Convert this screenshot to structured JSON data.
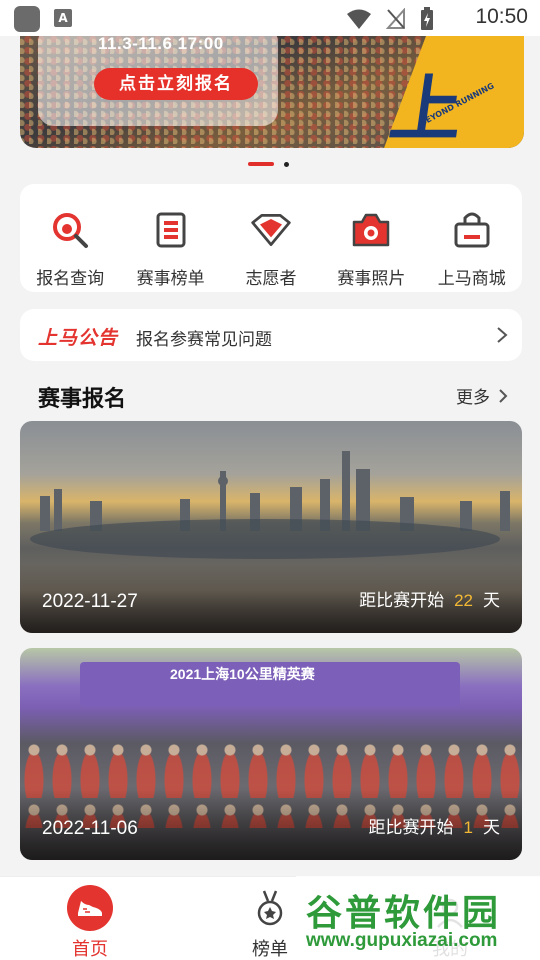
{
  "status_bar": {
    "time": "10:50"
  },
  "banner": {
    "date_text": "11.3-11.6 17:00",
    "button_label": "点击立刻报名",
    "logo_text": "上马",
    "logo_small": "BEYOND RUNNING"
  },
  "quick_menu": [
    {
      "label": "报名查询",
      "icon": "search-icon"
    },
    {
      "label": "赛事榜单",
      "icon": "list-icon"
    },
    {
      "label": "志愿者",
      "icon": "diamond-icon"
    },
    {
      "label": "赛事照片",
      "icon": "camera-icon"
    },
    {
      "label": "上马商城",
      "icon": "shop-bag-icon"
    }
  ],
  "notice": {
    "tag": "上马公告",
    "text": "报名参赛常见问题"
  },
  "section": {
    "title": "赛事报名",
    "more": "更多"
  },
  "races": [
    {
      "date": "2022-11-27",
      "countdown_prefix": "距比赛开始",
      "days": "22",
      "unit": "天"
    },
    {
      "date": "2022-11-06",
      "countdown_prefix": "距比赛开始",
      "days": "1",
      "unit": "天",
      "arch_text": "2021上海10公里精英赛"
    }
  ],
  "bottom_nav": {
    "home": "首页",
    "rank": "榜单",
    "mine": "我的"
  },
  "watermark": {
    "main": "谷普软件园",
    "url": "www.gupuxiazai.com"
  },
  "colors": {
    "accent": "#e3342f",
    "highlight": "#f3b934"
  }
}
